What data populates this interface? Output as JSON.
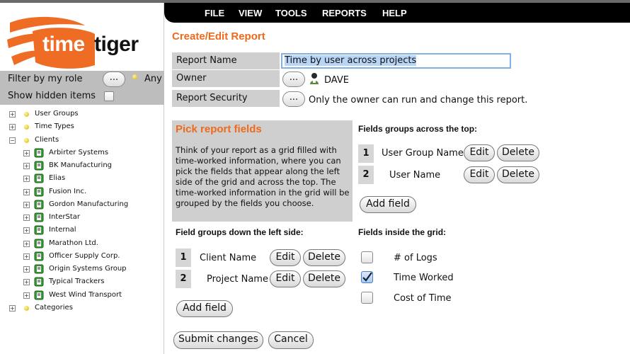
{
  "menu": {
    "file": "FILE",
    "view": "VIEW",
    "tools": "TOOLS",
    "reports": "REPORTS",
    "help": "HELP"
  },
  "logo": {
    "word1": "time",
    "word2": "tiger",
    "colors": {
      "brand_orange": "#ef6c24",
      "dark": "#111111"
    }
  },
  "sidebar": {
    "filter_label": "Filter by my role",
    "filter_button": "...",
    "filter_value": "Any",
    "hidden_label": "Show hidden items",
    "show_hidden_checked": false,
    "tree": [
      {
        "label": "User Groups",
        "expander": "+"
      },
      {
        "label": "Time Types",
        "expander": "+"
      },
      {
        "label": "Clients",
        "expander": "−"
      },
      {
        "label": "Arbirter Systems",
        "expander": "+",
        "child": true
      },
      {
        "label": "BK Manufacturing",
        "expander": "+",
        "child": true
      },
      {
        "label": "Elias",
        "expander": "+",
        "child": true
      },
      {
        "label": "Fusion Inc.",
        "expander": "+",
        "child": true
      },
      {
        "label": "Gordon Manufacturing",
        "expander": "+",
        "child": true
      },
      {
        "label": "InterStar",
        "expander": "+",
        "child": true
      },
      {
        "label": "Internal",
        "expander": "+",
        "child": true
      },
      {
        "label": "Marathon Ltd.",
        "expander": "+",
        "child": true
      },
      {
        "label": "Officer Supply Corp.",
        "expander": "+",
        "child": true
      },
      {
        "label": "Origin Systems Group",
        "expander": "+",
        "child": true
      },
      {
        "label": "Typical Trackers",
        "expander": "+",
        "child": true
      },
      {
        "label": "West Wind Transport",
        "expander": "+",
        "child": true
      },
      {
        "label": "Categories",
        "expander": "+"
      }
    ]
  },
  "main": {
    "title": "Create/Edit Report",
    "report_name_label": "Report Name",
    "report_name_value": "Time by user across projects",
    "owner_label": "Owner",
    "owner_button": "...",
    "owner_value": "DAVE",
    "security_label": "Report Security",
    "security_button": "...",
    "security_value": "Only the owner can run and change this report.",
    "pick_title": "Pick report fields",
    "pick_description": "Think of your report as a grid filled with time-worked information, where you can pick the fields that appear along the left side of the grid and across the top. The time-worked information in the grid will be grouped by the fields you choose.",
    "across_top": {
      "heading": "Fields groups across the top:",
      "fields": [
        {
          "num": "1",
          "name": "User Group Name",
          "edit": "Edit",
          "delete": "Delete"
        },
        {
          "num": "2",
          "name": "User Name",
          "edit": "Edit",
          "delete": "Delete"
        }
      ],
      "add_label": "Add field"
    },
    "down_left": {
      "heading": "Field groups down the left side:",
      "fields": [
        {
          "num": "1",
          "name": "Client Name",
          "edit": "Edit",
          "delete": "Delete"
        },
        {
          "num": "2",
          "name": "Project Name",
          "edit": "Edit",
          "delete": "Delete"
        }
      ],
      "add_label": "Add field"
    },
    "inside_grid": {
      "heading": "Fields inside the grid:",
      "fields": [
        {
          "name": "# of Logs",
          "checked": false
        },
        {
          "name": "Time Worked",
          "checked": true
        },
        {
          "name": "Cost of Time",
          "checked": false
        }
      ]
    },
    "submit_label": "Submit changes",
    "cancel_label": "Cancel"
  }
}
